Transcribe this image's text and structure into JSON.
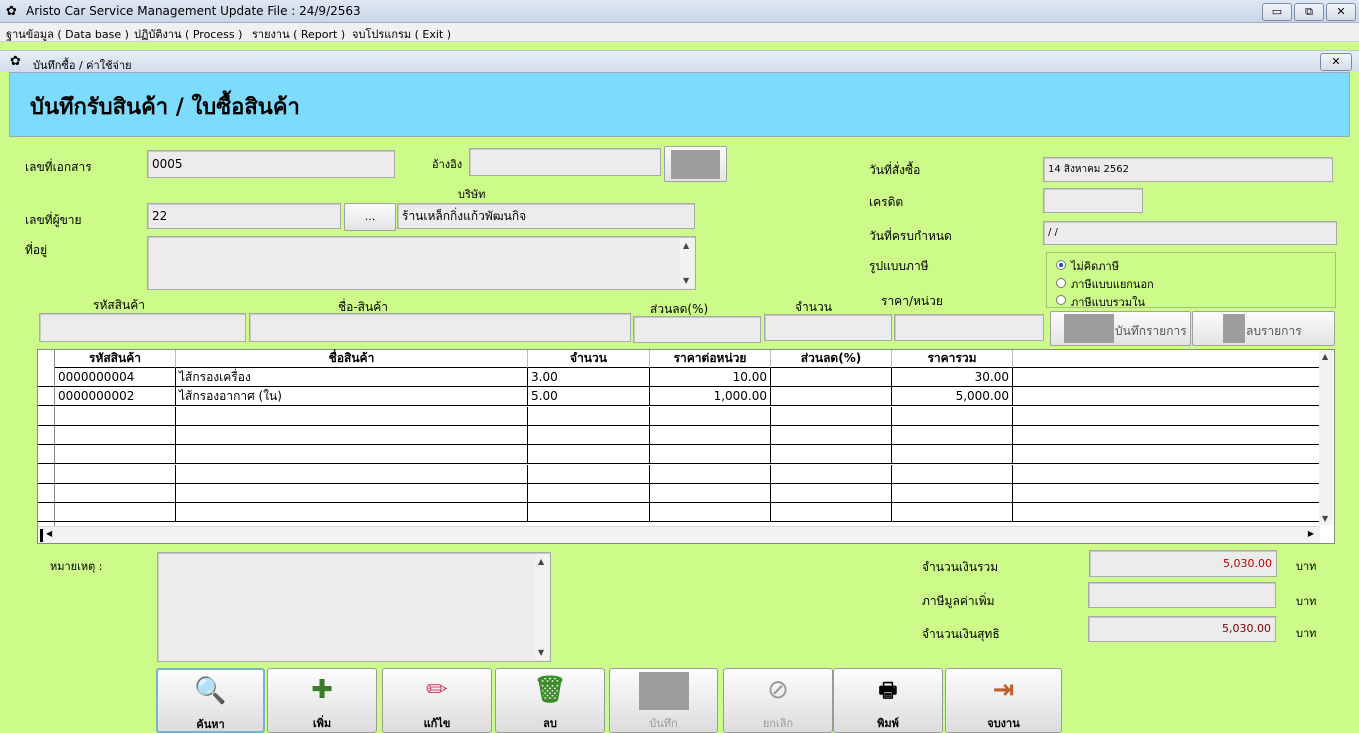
{
  "window": {
    "title": "Aristo Car Service Management   Update File : 24/9/2563",
    "min": "▭",
    "restore": "⧉",
    "close": "✕"
  },
  "menu": [
    "ฐานข้อมูล ( Data base )",
    "ปฏิบัติงาน ( Process )",
    "รายงาน ( Report )",
    "จบโปรแกรม ( Exit )"
  ],
  "child": {
    "title": "บันทึกซื้อ / ค่าใช้จ่าย",
    "close": "✕"
  },
  "header": {
    "title": "บันทึกรับสินค้า / ใบซื้อสินค้า"
  },
  "form": {
    "doc_no_label": "เลขที่เอกสาร",
    "doc_no": "0005",
    "ref_label": "อ้างอิง",
    "ref": "",
    "company_label": "บริษัท",
    "vendor_label": "เลขที่ผู้ขาย",
    "vendor_id": "22",
    "vendor_browse": "...",
    "vendor_name": "ร้านเหล็กกิ่งแก้วพัฒนกิจ",
    "address_label": "ที่อยู่",
    "address": "",
    "order_date_label": "วันที่สั่งซื้อ",
    "order_date": "14 สิงหาคม 2562",
    "credit_label": "เครดิต",
    "credit": "",
    "due_date_label": "วันที่ครบกำหนด",
    "due_date": " /  /",
    "tax_label": "รูปแบบภาษี",
    "tax_options": [
      "ไม่คิดภาษี",
      "ภาษีแบบแยกนอก",
      "ภาษีแบบรวมใน"
    ],
    "tax_selected": 0
  },
  "entry": {
    "code_label": "รหัสสินค้า",
    "name_label": "ชื่อ-สินค้า",
    "discount_label": "ส่วนลด(%)",
    "qty_label": "จำนวน",
    "price_label": "ราคา/หน่วย",
    "save_item": "บันทึกรายการ",
    "delete_item": "ลบรายการ"
  },
  "grid": {
    "columns": [
      "รหัสสินค้า",
      "ชื่อสินค้า",
      "จำนวน",
      "ราคาต่อหน่วย",
      "ส่วนลด(%)",
      "ราคารวม"
    ],
    "rows": [
      [
        "0000000004",
        "ไส้กรองเครื่อง",
        "3.00",
        "10.00",
        "",
        "30.00"
      ],
      [
        "0000000002",
        "ไส้กรองอากาศ (ใน)",
        "5.00",
        "1,000.00",
        "",
        "5,000.00"
      ],
      [
        "",
        "",
        "",
        "",
        "",
        ""
      ],
      [
        "",
        "",
        "",
        "",
        "",
        ""
      ],
      [
        "",
        "",
        "",
        "",
        "",
        ""
      ],
      [
        "",
        "",
        "",
        "",
        "",
        ""
      ],
      [
        "",
        "",
        "",
        "",
        "",
        ""
      ],
      [
        "",
        "",
        "",
        "",
        "",
        ""
      ]
    ]
  },
  "totals": {
    "note_label": "หมายเหตุ :",
    "note": "",
    "subtotal_label": "จำนวนเงินรวม",
    "subtotal": "5,030.00",
    "vat_label": "ภาษีมูลค่าเพิ่ม",
    "vat": "",
    "net_label": "จำนวนเงินสุทธิ",
    "net": "5,030.00",
    "currency": "บาท"
  },
  "toolbar": [
    {
      "label": "ค้นหา",
      "icon": "🔍",
      "name": "search"
    },
    {
      "label": "เพิ่ม",
      "icon": "✚",
      "name": "add"
    },
    {
      "label": "แก้ไข",
      "icon": "✏",
      "name": "edit"
    },
    {
      "label": "ลบ",
      "icon": "🗑",
      "name": "delete"
    },
    {
      "label": "บันทึก",
      "icon": "",
      "name": "save"
    },
    {
      "label": "ยกเลิก",
      "icon": "⊘",
      "name": "cancel"
    },
    {
      "label": "พิมพ์",
      "icon": "🖶",
      "name": "print"
    },
    {
      "label": "จบงาน",
      "icon": "⇥",
      "name": "exit"
    }
  ],
  "colors": {
    "form_bg": "#cdfb8a",
    "header_bg": "#7ddcfb",
    "total_red": "#c00000"
  }
}
